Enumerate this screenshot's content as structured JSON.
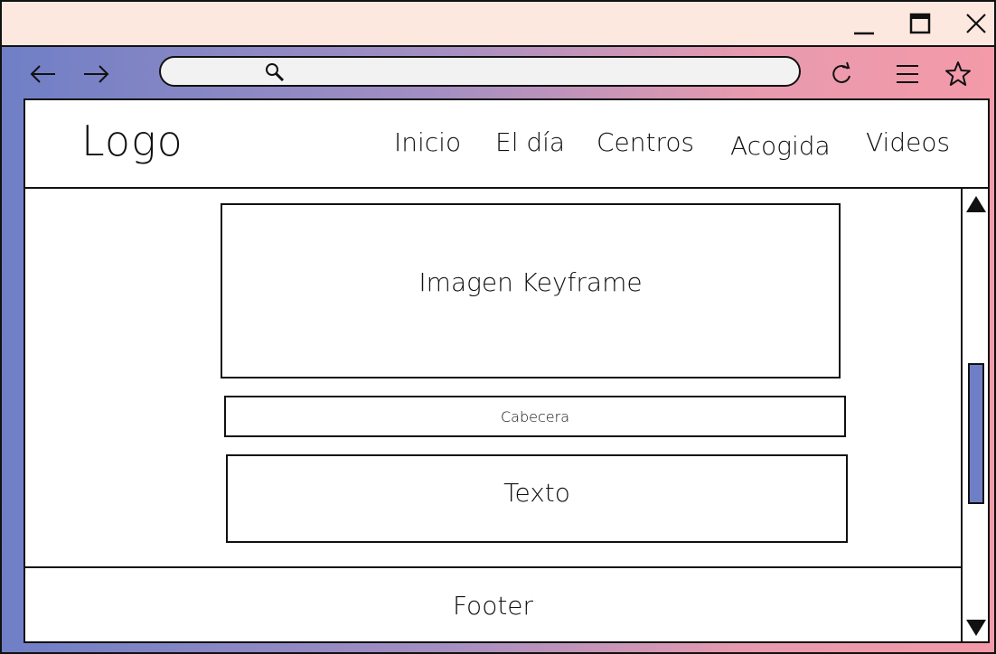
{
  "window": {
    "minimize_icon": "minimize-icon",
    "maximize_icon": "maximize-icon",
    "close_icon": "close-icon"
  },
  "browser": {
    "url_value": "",
    "icons": [
      "back-arrow-icon",
      "forward-arrow-icon",
      "search-icon",
      "reload-icon",
      "menu-icon",
      "star-icon"
    ]
  },
  "site": {
    "logo": "Logo",
    "nav": [
      "Inicio",
      "El día",
      "Centros",
      "Acogida",
      "Videos"
    ]
  },
  "content": {
    "keyframe": "Imagen Keyframe",
    "header": "Cabecera",
    "text": "Texto",
    "footer": "Footer"
  },
  "colors": {
    "titlebar": "#fde8e0",
    "gradient_start": "#6f7fc6",
    "gradient_end": "#f49aa8",
    "scroll_thumb": "#6f7fc6"
  }
}
